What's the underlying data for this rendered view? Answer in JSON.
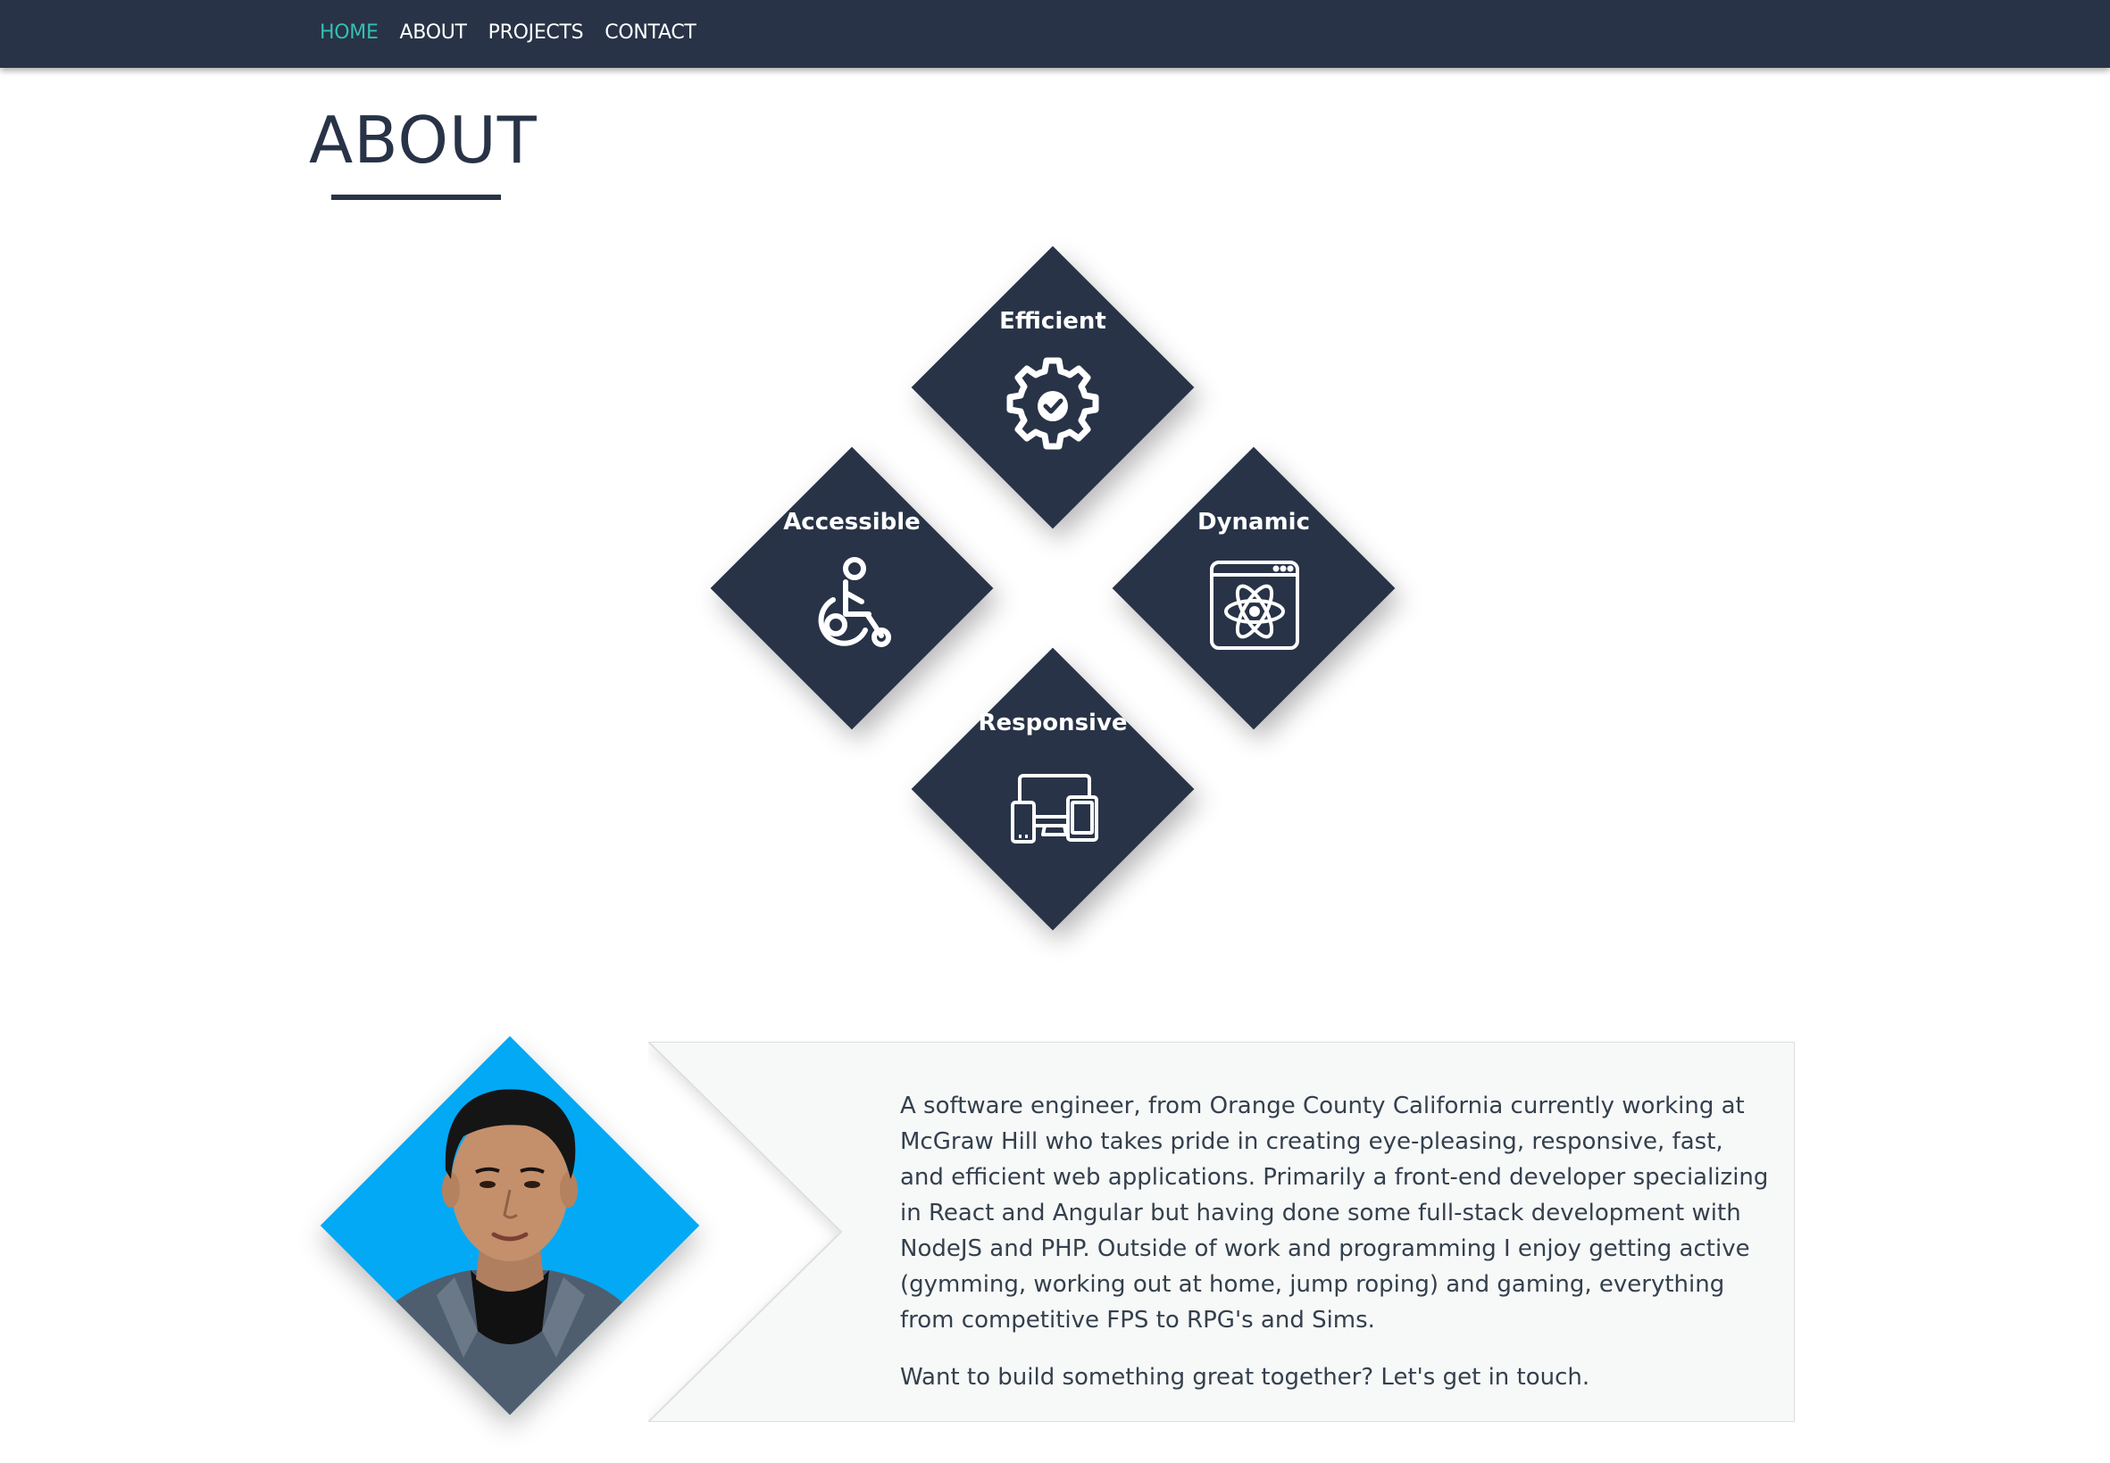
{
  "colors": {
    "navy": "#283347",
    "accent": "#35bfb1",
    "portrait_bg": "#03a9f4",
    "card_bg": "#f7f8f8",
    "text": "#34404d"
  },
  "nav": {
    "items": [
      {
        "label": "HOME",
        "active": true
      },
      {
        "label": "ABOUT",
        "active": false
      },
      {
        "label": "PROJECTS",
        "active": false
      },
      {
        "label": "CONTACT",
        "active": false
      }
    ]
  },
  "about": {
    "heading": "ABOUT"
  },
  "features": [
    {
      "title": "Efficient",
      "icon": "gear-check-icon"
    },
    {
      "title": "Accessible",
      "icon": "wheelchair-icon"
    },
    {
      "title": "Dynamic",
      "icon": "browser-atom-icon"
    },
    {
      "title": "Responsive",
      "icon": "devices-icon"
    }
  ],
  "bio": {
    "portrait_icon": "profile-photo",
    "paragraphs": [
      "A software engineer, from Orange County California currently working at McGraw Hill who takes pride in creating eye-pleasing, responsive, fast, and efficient web applications. Primarily a front-end developer specializing in React and Angular but having done some full-stack development with NodeJS and PHP. Outside of work and programming I enjoy getting active (gymming, working out at home, jump roping) and gaming, everything from competitive FPS to RPG's and Sims.",
      "Want to build something great together? Let's get in touch."
    ]
  }
}
